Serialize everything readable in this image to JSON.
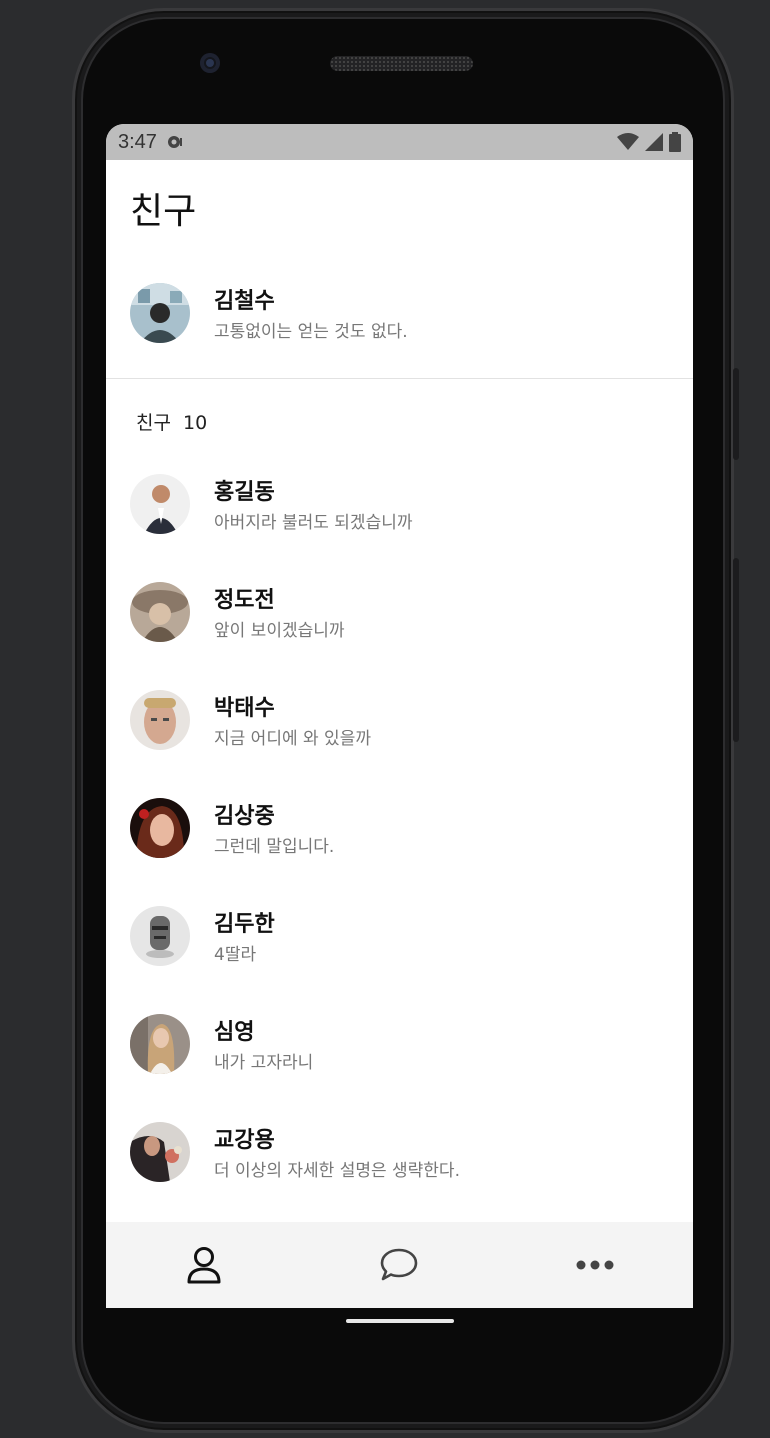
{
  "status_bar": {
    "time": "3:47"
  },
  "header": {
    "title": "친구"
  },
  "my_profile": {
    "name": "김철수",
    "status": "고통없이는 얻는 것도 없다."
  },
  "friends_section": {
    "label": "친구",
    "count": "10"
  },
  "friends": [
    {
      "name": "홍길동",
      "status": "아버지라 불러도 되겠습니까",
      "avatar_color": "#d8d8d8"
    },
    {
      "name": "정도전",
      "status": "앞이 보이겠습니까",
      "avatar_color": "#8a7a6a"
    },
    {
      "name": "박태수",
      "status": "지금 어디에 와 있을까",
      "avatar_color": "#c9b0a0"
    },
    {
      "name": "김상중",
      "status": "그런데 말입니다.",
      "avatar_color": "#5a2a20"
    },
    {
      "name": "김두한",
      "status": "4딸라",
      "avatar_color": "#c8c8c8"
    },
    {
      "name": "심영",
      "status": "내가 고자라니",
      "avatar_color": "#a89888"
    },
    {
      "name": "교강용",
      "status": "더 이상의 자세한 설명은 생략한다.",
      "avatar_color": "#3a3436"
    }
  ],
  "bottom_nav": {
    "items": [
      {
        "icon": "person-icon"
      },
      {
        "icon": "chat-bubble-icon"
      },
      {
        "icon": "more-dots-icon"
      }
    ]
  },
  "colors": {
    "status_bar_bg": "#bdbdbd",
    "bottom_nav_bg": "#f4f4f4",
    "name_text": "#111111",
    "status_text": "#777777"
  }
}
